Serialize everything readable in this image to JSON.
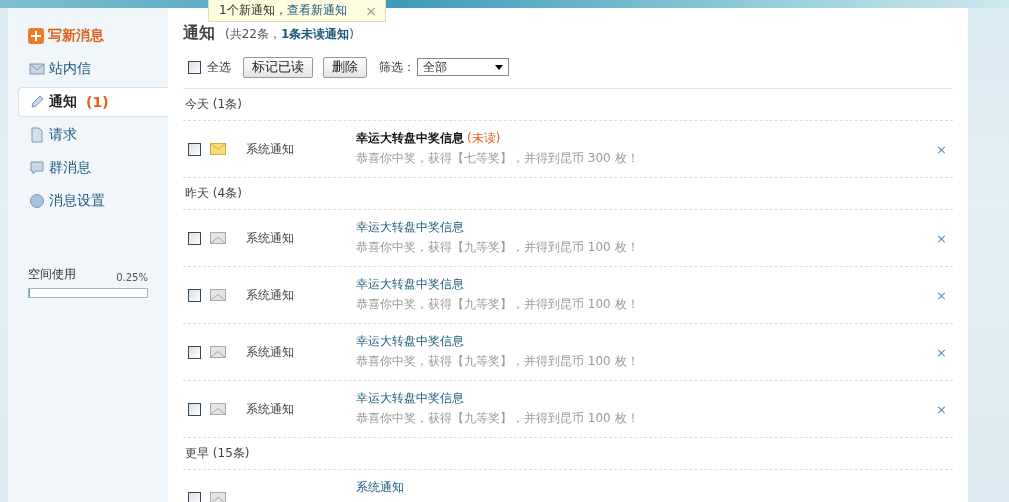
{
  "toast": {
    "text": "1个新通知，",
    "link": "查看新通知",
    "close": "×"
  },
  "sidebar": {
    "compose": "写新消息",
    "items": [
      {
        "label": "站内信",
        "selected": false
      },
      {
        "label": "通知",
        "count": "(1)",
        "selected": true
      },
      {
        "label": "请求",
        "selected": false
      },
      {
        "label": "群消息",
        "selected": false
      },
      {
        "label": "消息设置",
        "selected": false
      }
    ],
    "storage": {
      "label": "空间使用",
      "reading": "0.25%",
      "level": 0.0025
    }
  },
  "header": {
    "title": "通知",
    "summary": "(共22条，**1条未读通知**)"
  },
  "toolbar": {
    "select_all": {
      "label": "全选",
      "checked": false
    },
    "buttons": [
      "标记已读",
      "删除"
    ],
    "filter_label": "筛选：",
    "filter_value": "全部"
  },
  "groups": [
    {
      "heading": "今天 (1条)",
      "rows": [
        {
          "checked": false,
          "unread": true,
          "sender": "系统通知",
          "title": "幸运大转盘中奖信息",
          "unread_label": "(未读)",
          "body": "恭喜你中奖，获得【七等奖】，并得到昆币 300 枚！",
          "close": "×"
        }
      ]
    },
    {
      "heading": "昨天 (4条)",
      "rows": [
        {
          "checked": false,
          "unread": false,
          "sender": "系统通知",
          "title": "幸运大转盘中奖信息",
          "body": "恭喜你中奖，获得【九等奖】，并得到昆币 100 枚！",
          "close": "×"
        },
        {
          "checked": false,
          "unread": false,
          "sender": "系统通知",
          "title": "幸运大转盘中奖信息",
          "body": "恭喜你中奖，获得【九等奖】，并得到昆币 100 枚！",
          "close": "×"
        },
        {
          "checked": false,
          "unread": false,
          "sender": "系统通知",
          "title": "幸运大转盘中奖信息",
          "body": "恭喜你中奖，获得【九等奖】，并得到昆币 100 枚！",
          "close": "×"
        },
        {
          "checked": false,
          "unread": false,
          "sender": "系统通知",
          "title": "幸运大转盘中奖信息",
          "body": "恭喜你中奖，获得【九等奖】，并得到昆币 100 枚！",
          "close": "×"
        }
      ]
    },
    {
      "heading": "更早 (15条)",
      "rows": [
        {
          "checked": false,
          "unread": false,
          "title": "系统通知"
        }
      ]
    }
  ]
}
